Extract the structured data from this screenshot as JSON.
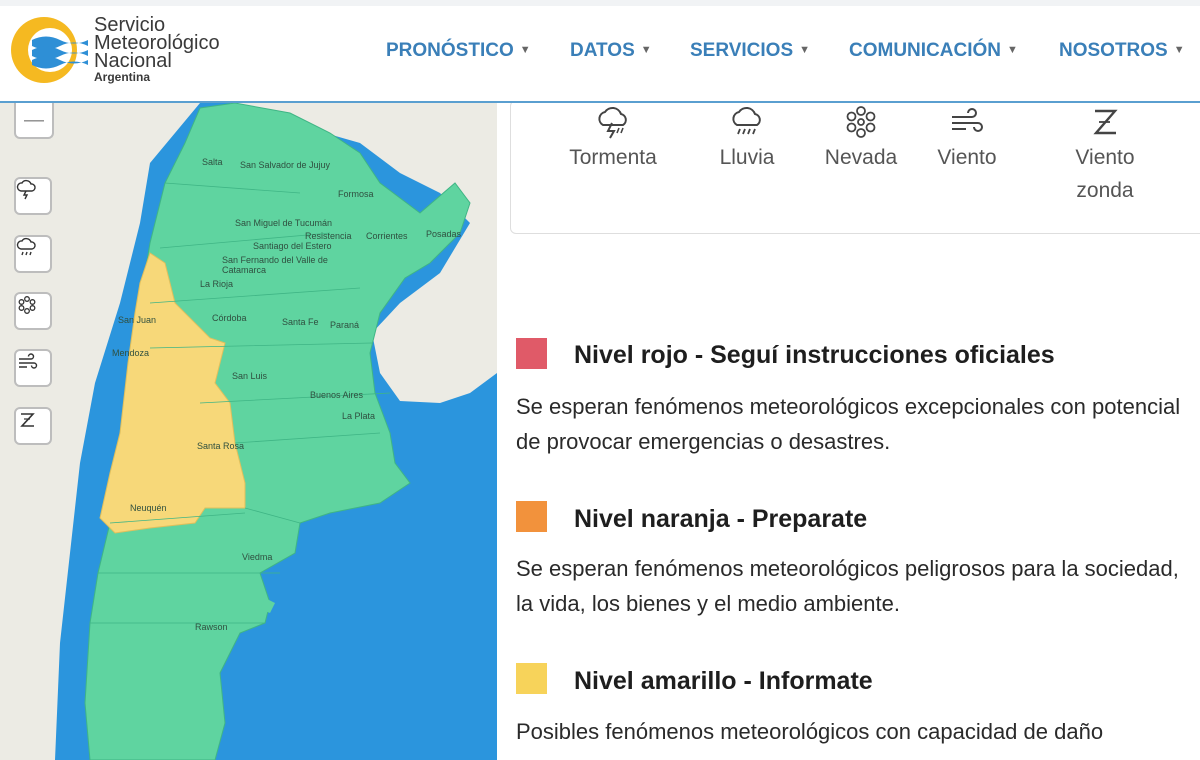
{
  "header": {
    "logo": {
      "line1": "Servicio",
      "line2": "Meteorológico",
      "line3": "Nacional",
      "line4": "Argentina"
    },
    "nav": [
      {
        "label": "PRONÓSTICO"
      },
      {
        "label": "DATOS"
      },
      {
        "label": "SERVICIOS"
      },
      {
        "label": "COMUNICACIÓN"
      },
      {
        "label": "NOSOTROS"
      }
    ],
    "nav_caret": "▼"
  },
  "map": {
    "zoom_out_label": "—",
    "tool_icons": [
      "storm-icon",
      "rain-icon",
      "snow-icon",
      "wind-icon",
      "zonda-wind-icon"
    ],
    "cities": [
      "Salta",
      "San Salvador de Jujuy",
      "Formosa",
      "San Miguel de Tucumán",
      "Resistencia",
      "Corrientes",
      "Posadas",
      "Santiago del Estero",
      "San Fernando del Valle de Catamarca",
      "La Rioja",
      "San Juan",
      "Córdoba",
      "Santa Fe",
      "Paraná",
      "Mendoza",
      "San Luis",
      "Buenos Aires",
      "La Plata",
      "Santa Rosa",
      "Neuquén",
      "Viedma",
      "Rawson"
    ],
    "colors": {
      "ocean": "#2b95dd",
      "green": "#5fd4a0",
      "yellow": "#f7d879",
      "neighbor": "#ecebe4"
    }
  },
  "phenomena": [
    {
      "label": "Tormenta",
      "icon": "storm-icon"
    },
    {
      "label": "Lluvia",
      "icon": "rain-icon"
    },
    {
      "label": "Nevada",
      "icon": "snow-icon"
    },
    {
      "label": "Viento",
      "icon": "wind-icon"
    },
    {
      "label": "Viento zonda",
      "icon": "zonda-wind-icon"
    }
  ],
  "levels": [
    {
      "title": "Nivel rojo - Seguí instrucciones oficiales",
      "color": "#e05a68",
      "description": "Se esperan fenómenos meteorológicos excepcionales con potencial de provocar emergencias o desastres."
    },
    {
      "title": "Nivel naranja - Preparate",
      "color": "#f2923c",
      "description": "Se esperan fenómenos meteorológicos peligrosos para la sociedad, la vida, los bienes y el medio ambiente."
    },
    {
      "title": "Nivel amarillo - Informate",
      "color": "#f7d35a",
      "description": "Posibles fenómenos meteorológicos con capacidad de daño"
    }
  ]
}
